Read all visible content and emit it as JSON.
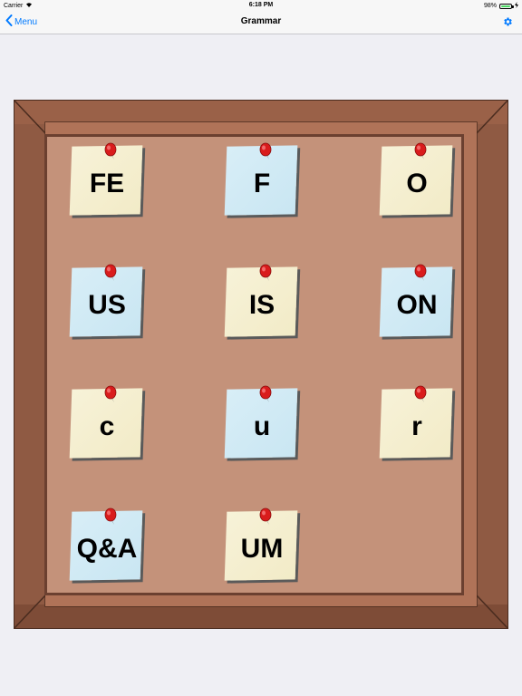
{
  "status_bar": {
    "carrier": "Carrier",
    "time": "6:18 PM",
    "battery": "98%"
  },
  "nav": {
    "back_label": "Menu",
    "title": "Grammar"
  },
  "colors": {
    "accent": "#007aff",
    "frame": "#8f5a43",
    "cork": "#c4927a",
    "note_yellow": "#f4eecf",
    "note_blue": "#cfe9f4",
    "pin": "#e02020"
  },
  "notes": [
    {
      "label": "FE",
      "color": "yellow"
    },
    {
      "label": "F",
      "color": "blue"
    },
    {
      "label": "O",
      "color": "yellow"
    },
    {
      "label": "US",
      "color": "blue"
    },
    {
      "label": "IS",
      "color": "yellow"
    },
    {
      "label": "ON",
      "color": "blue"
    },
    {
      "label": "c",
      "color": "yellow"
    },
    {
      "label": "u",
      "color": "blue"
    },
    {
      "label": "r",
      "color": "yellow"
    },
    {
      "label": "Q&A",
      "color": "blue"
    },
    {
      "label": "UM",
      "color": "yellow"
    }
  ]
}
